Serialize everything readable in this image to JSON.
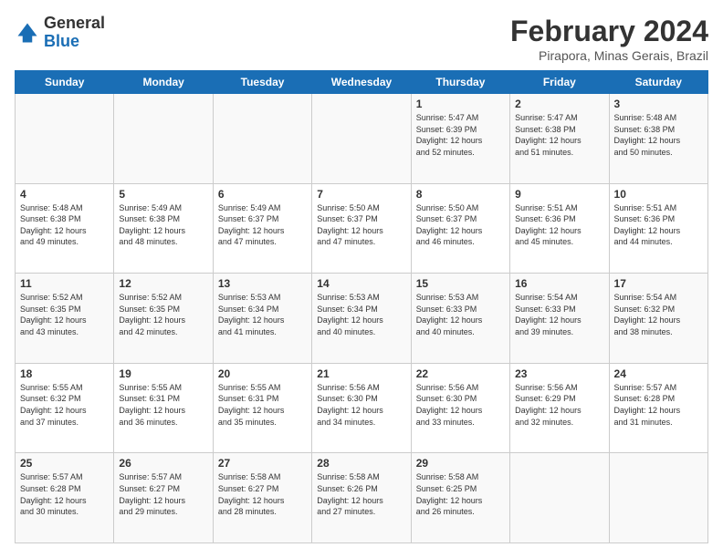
{
  "header": {
    "logo_line1": "General",
    "logo_line2": "Blue",
    "month_title": "February 2024",
    "location": "Pirapora, Minas Gerais, Brazil"
  },
  "days_of_week": [
    "Sunday",
    "Monday",
    "Tuesday",
    "Wednesday",
    "Thursday",
    "Friday",
    "Saturday"
  ],
  "weeks": [
    [
      {
        "day": "",
        "content": ""
      },
      {
        "day": "",
        "content": ""
      },
      {
        "day": "",
        "content": ""
      },
      {
        "day": "",
        "content": ""
      },
      {
        "day": "1",
        "content": "Sunrise: 5:47 AM\nSunset: 6:39 PM\nDaylight: 12 hours\nand 52 minutes."
      },
      {
        "day": "2",
        "content": "Sunrise: 5:47 AM\nSunset: 6:38 PM\nDaylight: 12 hours\nand 51 minutes."
      },
      {
        "day": "3",
        "content": "Sunrise: 5:48 AM\nSunset: 6:38 PM\nDaylight: 12 hours\nand 50 minutes."
      }
    ],
    [
      {
        "day": "4",
        "content": "Sunrise: 5:48 AM\nSunset: 6:38 PM\nDaylight: 12 hours\nand 49 minutes."
      },
      {
        "day": "5",
        "content": "Sunrise: 5:49 AM\nSunset: 6:38 PM\nDaylight: 12 hours\nand 48 minutes."
      },
      {
        "day": "6",
        "content": "Sunrise: 5:49 AM\nSunset: 6:37 PM\nDaylight: 12 hours\nand 47 minutes."
      },
      {
        "day": "7",
        "content": "Sunrise: 5:50 AM\nSunset: 6:37 PM\nDaylight: 12 hours\nand 47 minutes."
      },
      {
        "day": "8",
        "content": "Sunrise: 5:50 AM\nSunset: 6:37 PM\nDaylight: 12 hours\nand 46 minutes."
      },
      {
        "day": "9",
        "content": "Sunrise: 5:51 AM\nSunset: 6:36 PM\nDaylight: 12 hours\nand 45 minutes."
      },
      {
        "day": "10",
        "content": "Sunrise: 5:51 AM\nSunset: 6:36 PM\nDaylight: 12 hours\nand 44 minutes."
      }
    ],
    [
      {
        "day": "11",
        "content": "Sunrise: 5:52 AM\nSunset: 6:35 PM\nDaylight: 12 hours\nand 43 minutes."
      },
      {
        "day": "12",
        "content": "Sunrise: 5:52 AM\nSunset: 6:35 PM\nDaylight: 12 hours\nand 42 minutes."
      },
      {
        "day": "13",
        "content": "Sunrise: 5:53 AM\nSunset: 6:34 PM\nDaylight: 12 hours\nand 41 minutes."
      },
      {
        "day": "14",
        "content": "Sunrise: 5:53 AM\nSunset: 6:34 PM\nDaylight: 12 hours\nand 40 minutes."
      },
      {
        "day": "15",
        "content": "Sunrise: 5:53 AM\nSunset: 6:33 PM\nDaylight: 12 hours\nand 40 minutes."
      },
      {
        "day": "16",
        "content": "Sunrise: 5:54 AM\nSunset: 6:33 PM\nDaylight: 12 hours\nand 39 minutes."
      },
      {
        "day": "17",
        "content": "Sunrise: 5:54 AM\nSunset: 6:32 PM\nDaylight: 12 hours\nand 38 minutes."
      }
    ],
    [
      {
        "day": "18",
        "content": "Sunrise: 5:55 AM\nSunset: 6:32 PM\nDaylight: 12 hours\nand 37 minutes."
      },
      {
        "day": "19",
        "content": "Sunrise: 5:55 AM\nSunset: 6:31 PM\nDaylight: 12 hours\nand 36 minutes."
      },
      {
        "day": "20",
        "content": "Sunrise: 5:55 AM\nSunset: 6:31 PM\nDaylight: 12 hours\nand 35 minutes."
      },
      {
        "day": "21",
        "content": "Sunrise: 5:56 AM\nSunset: 6:30 PM\nDaylight: 12 hours\nand 34 minutes."
      },
      {
        "day": "22",
        "content": "Sunrise: 5:56 AM\nSunset: 6:30 PM\nDaylight: 12 hours\nand 33 minutes."
      },
      {
        "day": "23",
        "content": "Sunrise: 5:56 AM\nSunset: 6:29 PM\nDaylight: 12 hours\nand 32 minutes."
      },
      {
        "day": "24",
        "content": "Sunrise: 5:57 AM\nSunset: 6:28 PM\nDaylight: 12 hours\nand 31 minutes."
      }
    ],
    [
      {
        "day": "25",
        "content": "Sunrise: 5:57 AM\nSunset: 6:28 PM\nDaylight: 12 hours\nand 30 minutes."
      },
      {
        "day": "26",
        "content": "Sunrise: 5:57 AM\nSunset: 6:27 PM\nDaylight: 12 hours\nand 29 minutes."
      },
      {
        "day": "27",
        "content": "Sunrise: 5:58 AM\nSunset: 6:27 PM\nDaylight: 12 hours\nand 28 minutes."
      },
      {
        "day": "28",
        "content": "Sunrise: 5:58 AM\nSunset: 6:26 PM\nDaylight: 12 hours\nand 27 minutes."
      },
      {
        "day": "29",
        "content": "Sunrise: 5:58 AM\nSunset: 6:25 PM\nDaylight: 12 hours\nand 26 minutes."
      },
      {
        "day": "",
        "content": ""
      },
      {
        "day": "",
        "content": ""
      }
    ]
  ]
}
